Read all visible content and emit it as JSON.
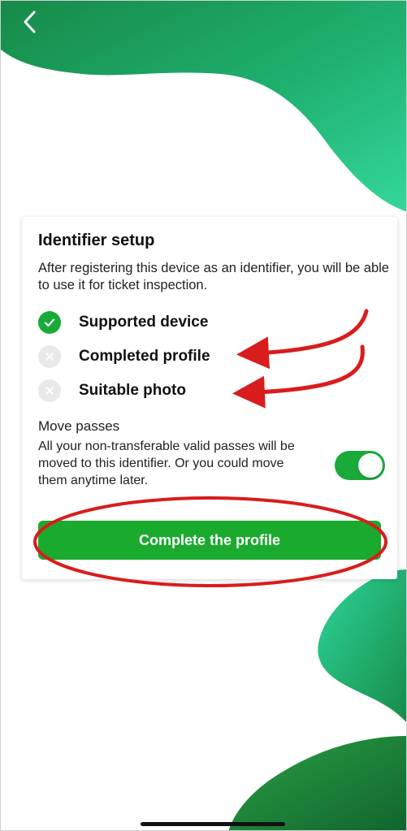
{
  "nav": {
    "back_icon": "chevron-left-icon"
  },
  "card": {
    "title": "Identifier setup",
    "description": "After registering this device as an identifier, you will be able to use it for ticket inspection.",
    "checks": [
      {
        "label": "Supported device",
        "status": "done"
      },
      {
        "label": "Completed profile",
        "status": "missing"
      },
      {
        "label": "Suitable photo",
        "status": "missing"
      }
    ],
    "move_passes": {
      "title": "Move passes",
      "description": "All your non-transferable valid passes will be moved to this identifier. Or you could move them anytime later.",
      "toggle_on": true
    },
    "cta_label": "Complete the profile"
  },
  "colors": {
    "accent_green": "#1aaa2e",
    "bg_green_dark": "#1a8f4a",
    "bg_green_light": "#2ecf8e",
    "annotation_red": "#d91c1c"
  }
}
